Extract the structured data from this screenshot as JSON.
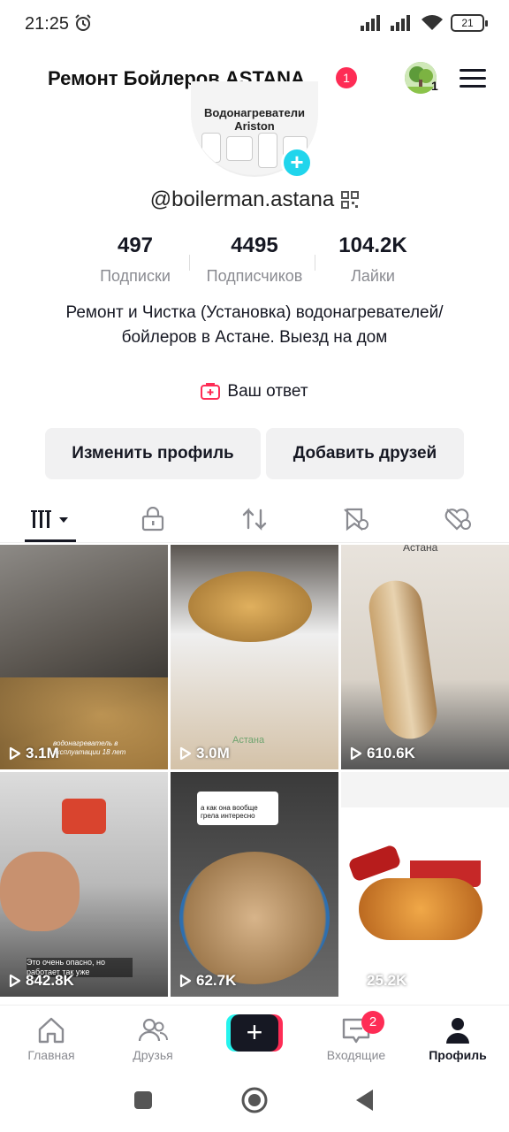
{
  "status_bar": {
    "time": "21:25",
    "battery": "21"
  },
  "header": {
    "title": "Ремонт Бойлеров ASTANA",
    "notification_count": "1",
    "friends_avatar_count": "1"
  },
  "profile": {
    "avatar_text_line1": "Водонагреватели",
    "avatar_text_line2": "Ariston",
    "username": "@boilerman.astana",
    "stats": [
      {
        "value": "497",
        "label": "Подписки"
      },
      {
        "value": "4495",
        "label": "Подписчиков"
      },
      {
        "value": "104.2K",
        "label": "Лайки"
      }
    ],
    "bio": "Ремонт и Чистка (Установка) водонагревателей/бойлеров в Астане. Выезд на дом",
    "answer_label": "Ваш ответ",
    "edit_profile_label": "Изменить профиль",
    "add_friends_label": "Добавить друзей"
  },
  "tabs": [
    {
      "name": "videos",
      "icon": "grid-icon"
    },
    {
      "name": "private",
      "icon": "lock-icon"
    },
    {
      "name": "reposts",
      "icon": "repost-icon"
    },
    {
      "name": "favorites",
      "icon": "hidden-bookmark-icon"
    },
    {
      "name": "liked",
      "icon": "hidden-heart-icon"
    }
  ],
  "videos": [
    {
      "views": "3.1M",
      "caption": "водонагреватель в эксплуатации 18 лет"
    },
    {
      "views": "3.0M",
      "caption": "Астана"
    },
    {
      "views": "610.6K",
      "caption": "Астана"
    },
    {
      "views": "842.8K",
      "caption": "Это очень опасно, но работает так уже"
    },
    {
      "views": "62.7K",
      "caption": "а как она вообще грела интересно"
    },
    {
      "views": "25.2K",
      "caption": ""
    }
  ],
  "bottom_nav": [
    {
      "label": "Главная",
      "icon": "home-icon"
    },
    {
      "label": "Друзья",
      "icon": "friends-icon"
    },
    {
      "label": "",
      "icon": "create-icon"
    },
    {
      "label": "Входящие",
      "icon": "inbox-icon",
      "badge": "2"
    },
    {
      "label": "Профиль",
      "icon": "profile-icon"
    }
  ],
  "colors": {
    "accent": "#fe2c55",
    "cyan": "#20d5ec",
    "text": "#161823",
    "muted": "#8a8b91"
  }
}
